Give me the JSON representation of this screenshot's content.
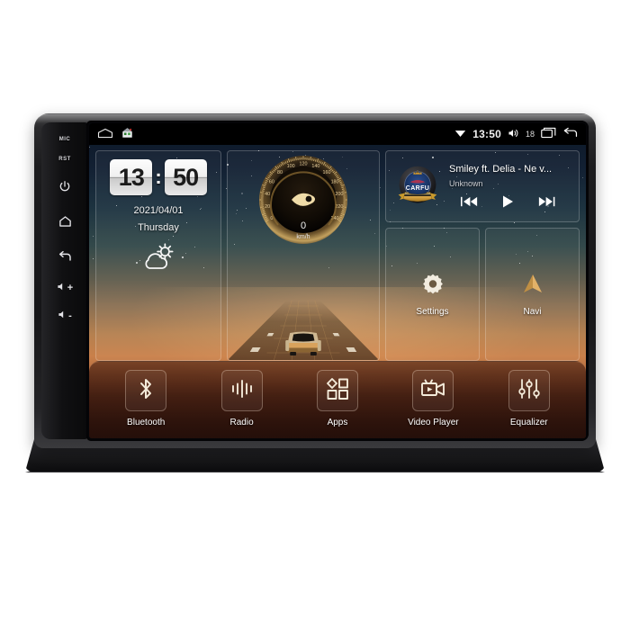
{
  "device": {
    "left_keys": [
      {
        "name": "mic-label",
        "label": "MIC",
        "type": "text"
      },
      {
        "name": "reset-label",
        "label": "RST",
        "type": "text"
      },
      {
        "name": "power-key",
        "label": "Power",
        "type": "icon"
      },
      {
        "name": "home-key",
        "label": "Home",
        "type": "icon"
      },
      {
        "name": "back-key",
        "label": "Back",
        "type": "icon"
      },
      {
        "name": "volume-up-key",
        "label": "+",
        "type": "vol"
      },
      {
        "name": "volume-down-key",
        "label": "-",
        "type": "vol"
      }
    ]
  },
  "statusbar": {
    "left_icons": [
      "window-outline-icon",
      "home-house-icon"
    ],
    "wifi_icon": "wifi-icon",
    "time": "13:50",
    "volume_icon": "volume-icon",
    "volume_level": "18",
    "recents_icon": "recents-icon",
    "back_icon": "back-icon"
  },
  "clock_widget": {
    "hours": "13",
    "minutes": "50",
    "separator": ":",
    "date": "2021/04/01",
    "weekday": "Thursday",
    "weather_icon": "partly-cloudy-icon"
  },
  "speedometer": {
    "value": "0",
    "unit": "km/h",
    "ticks": [
      "0",
      "20",
      "40",
      "60",
      "80",
      "100",
      "120",
      "140",
      "160",
      "180",
      "200",
      "220",
      "240"
    ],
    "min": 0,
    "max": 240,
    "needle_icon": "speed-needle-icon",
    "car_icon": "car-on-road-icon"
  },
  "music": {
    "logo_text": "CARFU",
    "title": "Smiley ft. Delia - Ne v...",
    "artist": "Unknown",
    "controls": [
      {
        "name": "previous-track-button",
        "icon": "skip-previous-icon"
      },
      {
        "name": "play-button",
        "icon": "play-icon"
      },
      {
        "name": "next-track-button",
        "icon": "skip-next-icon"
      }
    ]
  },
  "tiles": [
    {
      "name": "settings-tile",
      "label": "Settings",
      "icon": "gear-icon"
    },
    {
      "name": "navi-tile",
      "label": "Navi",
      "icon": "navigation-arrow-icon"
    }
  ],
  "dock": [
    {
      "name": "bluetooth-app",
      "label": "Bluetooth",
      "icon": "bluetooth-icon"
    },
    {
      "name": "radio-app",
      "label": "Radio",
      "icon": "radio-waves-icon"
    },
    {
      "name": "apps-app",
      "label": "Apps",
      "icon": "apps-grid-icon"
    },
    {
      "name": "video-player-app",
      "label": "Video Player",
      "icon": "video-camera-icon"
    },
    {
      "name": "equalizer-app",
      "label": "Equalizer",
      "icon": "equalizer-sliders-icon"
    }
  ],
  "colors": {
    "accent_gold": "#e0b060",
    "screen_dark": "#0c1726",
    "horizon_orange": "#c9804a",
    "dock_brown": "#3a170d",
    "logo_blue": "#16305e"
  }
}
